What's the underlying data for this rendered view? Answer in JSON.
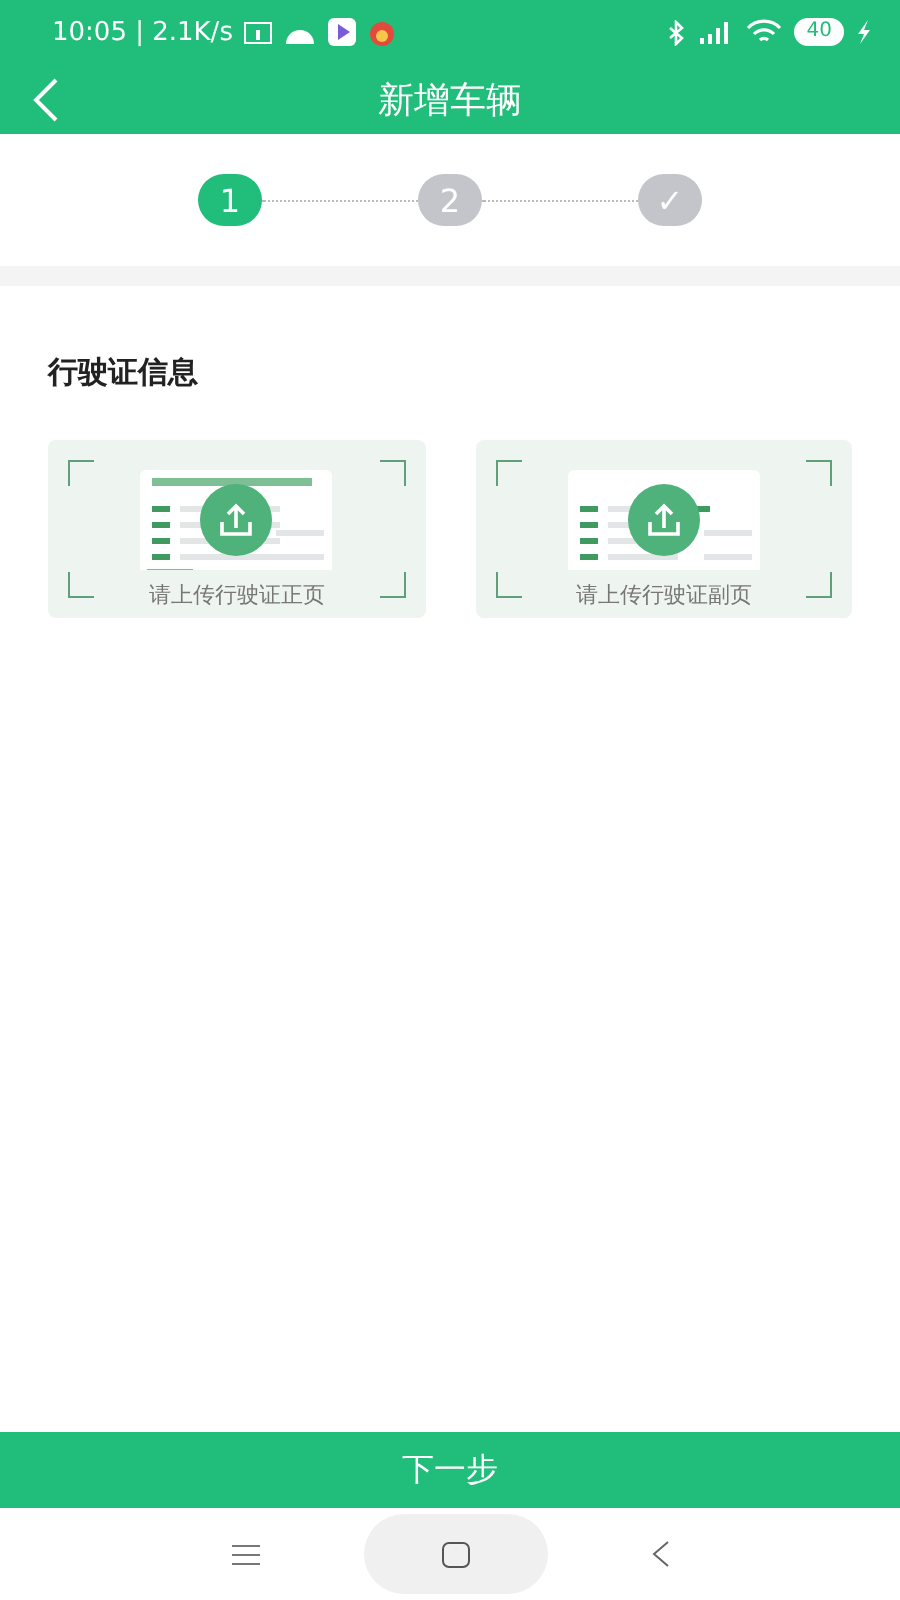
{
  "status_bar": {
    "time": "10:05 | 2.1K/s",
    "battery": "40"
  },
  "header": {
    "title": "新增车辆"
  },
  "steps": [
    {
      "label": "1",
      "selected": true
    },
    {
      "label": "2",
      "selected": false
    },
    {
      "label": "✓",
      "selected": false
    }
  ],
  "section": {
    "title": "行驶证信息"
  },
  "uploads": [
    {
      "kind": "front",
      "label": "请上传行驶证正页"
    },
    {
      "kind": "back",
      "label": "请上传行驶证副页"
    }
  ],
  "next_button": "下一步"
}
